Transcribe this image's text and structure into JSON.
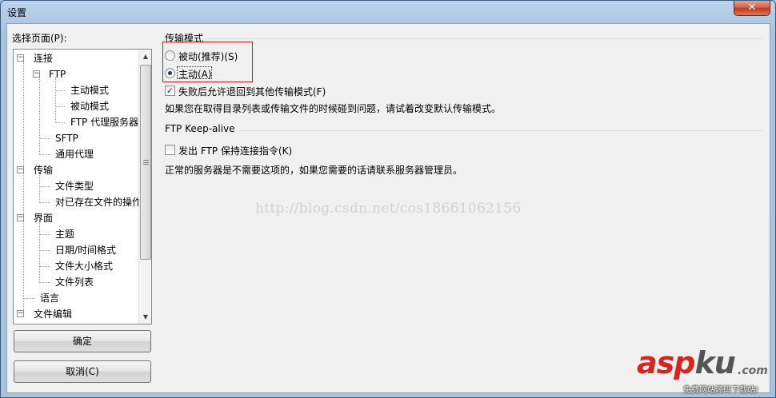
{
  "window": {
    "title": "设置",
    "close_label": "✕"
  },
  "sidebar": {
    "select_page_label": "选择页面(P):",
    "tree": [
      {
        "label": "连接"
      },
      {
        "label": "FTP"
      },
      {
        "label": "主动模式"
      },
      {
        "label": "被动模式"
      },
      {
        "label": "FTP 代理服务器"
      },
      {
        "label": "SFTP"
      },
      {
        "label": "通用代理"
      },
      {
        "label": "传输"
      },
      {
        "label": "文件类型"
      },
      {
        "label": "对已存在文件的操作"
      },
      {
        "label": "界面"
      },
      {
        "label": "主题"
      },
      {
        "label": "日期/时间格式"
      },
      {
        "label": "文件大小格式"
      },
      {
        "label": "文件列表"
      },
      {
        "label": "语言"
      },
      {
        "label": "文件编辑"
      }
    ],
    "ok_label": "确定",
    "cancel_label": "取消(C)"
  },
  "transfer_mode": {
    "title": "传输模式",
    "passive_label": "被动(推荐)(S)",
    "active_label": "主动(A)",
    "selected": "active",
    "fallback_label": "失败后允许退回到其他传输模式(F)",
    "fallback_checked": true,
    "hint": "如果您在取得目录列表或传输文件的时候碰到问题，请试着改变默认传输模式。"
  },
  "keepalive": {
    "title": "FTP Keep-alive",
    "send_label": "发出 FTP 保持连接指令(K)",
    "send_checked": false,
    "hint": "正常的服务器是不需要这项的，如果您需要的话请联系服务器管理员。"
  },
  "watermark": "http://blog.csdn.net/cos18661062156",
  "logo": {
    "main_a": "asp",
    "main_b": "ku",
    "tld": ".com",
    "sub": "免费网站源码下载站!"
  },
  "colors": {
    "highlight_box": "#e0141a",
    "logo_red": "#d8241d"
  }
}
